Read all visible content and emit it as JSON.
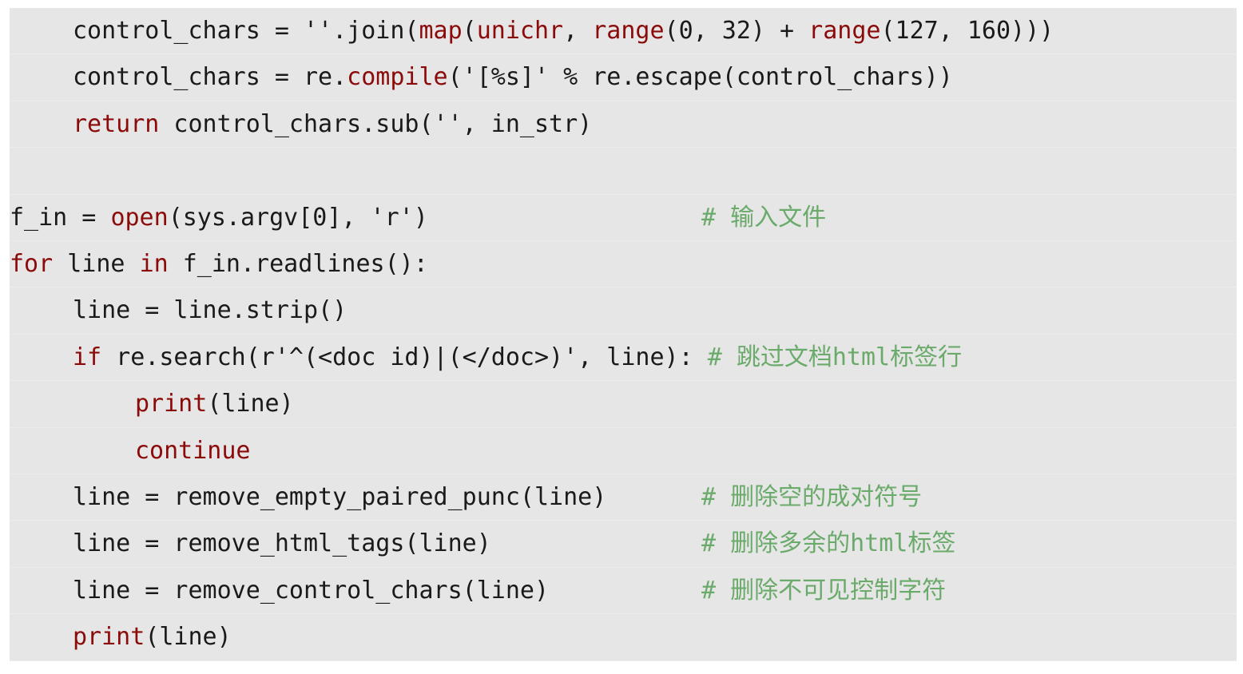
{
  "colors": {
    "background": "#e6e6e6",
    "text": "#1a1a1a",
    "keyword": "#8b0a0a",
    "comment": "#6aaa6a"
  },
  "lines": [
    {
      "indent": 1,
      "tokens": [
        {
          "t": "control_chars = ''.join(",
          "c": "plain"
        },
        {
          "t": "map",
          "c": "kw"
        },
        {
          "t": "(",
          "c": "plain"
        },
        {
          "t": "unichr",
          "c": "kw"
        },
        {
          "t": ", ",
          "c": "plain"
        },
        {
          "t": "range",
          "c": "kw"
        },
        {
          "t": "(0, 32) + ",
          "c": "plain"
        },
        {
          "t": "range",
          "c": "kw"
        },
        {
          "t": "(127, 160)))",
          "c": "plain"
        }
      ]
    },
    {
      "indent": 1,
      "tokens": [
        {
          "t": "control_chars = re.",
          "c": "plain"
        },
        {
          "t": "compile",
          "c": "kw"
        },
        {
          "t": "('[%s]' % re.escape(control_chars))",
          "c": "plain"
        }
      ]
    },
    {
      "indent": 1,
      "tokens": [
        {
          "t": "return",
          "c": "kw"
        },
        {
          "t": " control_chars.sub('', in_str)",
          "c": "plain"
        }
      ]
    },
    {
      "indent": 0,
      "tokens": []
    },
    {
      "indent": 0,
      "tokens": [
        {
          "t": "f_in = ",
          "c": "plain"
        },
        {
          "t": "open",
          "c": "kw"
        },
        {
          "t": "(sys.argv[0], 'r')",
          "c": "plain"
        }
      ],
      "comment": "# 输入文件"
    },
    {
      "indent": 0,
      "tokens": [
        {
          "t": "for",
          "c": "kw"
        },
        {
          "t": " line ",
          "c": "plain"
        },
        {
          "t": "in",
          "c": "kw"
        },
        {
          "t": " f_in.readlines():",
          "c": "plain"
        }
      ]
    },
    {
      "indent": 1,
      "tokens": [
        {
          "t": "line = line.strip()",
          "c": "plain"
        }
      ]
    },
    {
      "indent": 1,
      "tokens": [
        {
          "t": "if",
          "c": "kw"
        },
        {
          "t": " re.search(r'^(<doc id)|(</doc>)', line): ",
          "c": "plain"
        },
        {
          "t": "# 跳过文档html标签行",
          "c": "cm"
        }
      ]
    },
    {
      "indent": 2,
      "tokens": [
        {
          "t": "print",
          "c": "kw"
        },
        {
          "t": "(line)",
          "c": "plain"
        }
      ]
    },
    {
      "indent": 2,
      "tokens": [
        {
          "t": "continue",
          "c": "kw"
        }
      ]
    },
    {
      "indent": 1,
      "tokens": [
        {
          "t": "line = remove_empty_paired_punc(line)",
          "c": "plain"
        }
      ],
      "comment": "# 删除空的成对符号"
    },
    {
      "indent": 1,
      "tokens": [
        {
          "t": "line = remove_html_tags(line)",
          "c": "plain"
        }
      ],
      "comment": "# 删除多余的html标签"
    },
    {
      "indent": 1,
      "tokens": [
        {
          "t": "line = remove_control_chars(line)",
          "c": "plain"
        }
      ],
      "comment": "# 删除不可见控制字符"
    },
    {
      "indent": 1,
      "tokens": [
        {
          "t": "print",
          "c": "kw"
        },
        {
          "t": "(line)",
          "c": "plain"
        }
      ]
    }
  ]
}
